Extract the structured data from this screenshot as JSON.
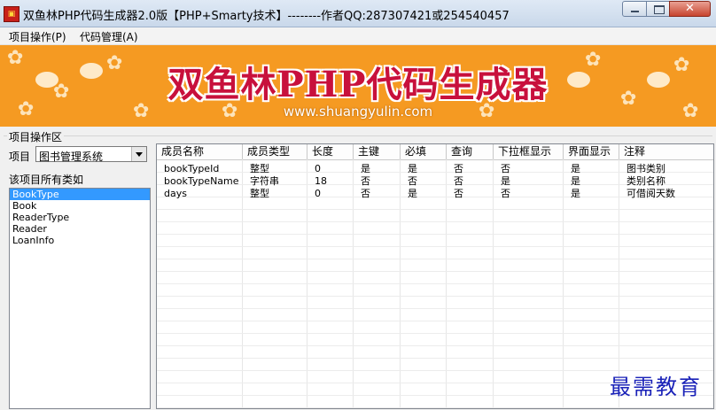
{
  "window": {
    "title": "双鱼林PHP代码生成器2.0版【PHP+Smarty技术】--------作者QQ:287307421或254540457"
  },
  "menu": [
    "项目操作(P)",
    "代码管理(A)"
  ],
  "banner": {
    "title": "双鱼林PHP代码生成器",
    "url": "www.shuangyulin.com"
  },
  "group_label": "项目操作区",
  "project": {
    "label": "项目",
    "selected": "图书管理系统"
  },
  "classes": {
    "label": "该项目所有类如",
    "items": [
      "BookType",
      "Book",
      "ReaderType",
      "Reader",
      "LoanInfo"
    ],
    "selected_index": 0
  },
  "grid": {
    "columns": [
      "成员名称",
      "成员类型",
      "长度",
      "主键",
      "必填",
      "查询",
      "下拉框显示",
      "界面显示",
      "注释"
    ],
    "rows": [
      [
        "bookTypeId",
        "整型",
        "0",
        "是",
        "是",
        "否",
        "否",
        "是",
        "图书类别"
      ],
      [
        "bookTypeName",
        "字符串",
        "18",
        "否",
        "否",
        "否",
        "是",
        "是",
        "类别名称"
      ],
      [
        "days",
        "整型",
        "0",
        "否",
        "是",
        "否",
        "否",
        "是",
        "可借阅天数"
      ]
    ]
  },
  "watermark": "最需教育",
  "colors": {
    "banner_bg": "#f59a22",
    "banner_title": "#c8103c",
    "selection": "#3399ff",
    "watermark": "#1a22b8"
  }
}
